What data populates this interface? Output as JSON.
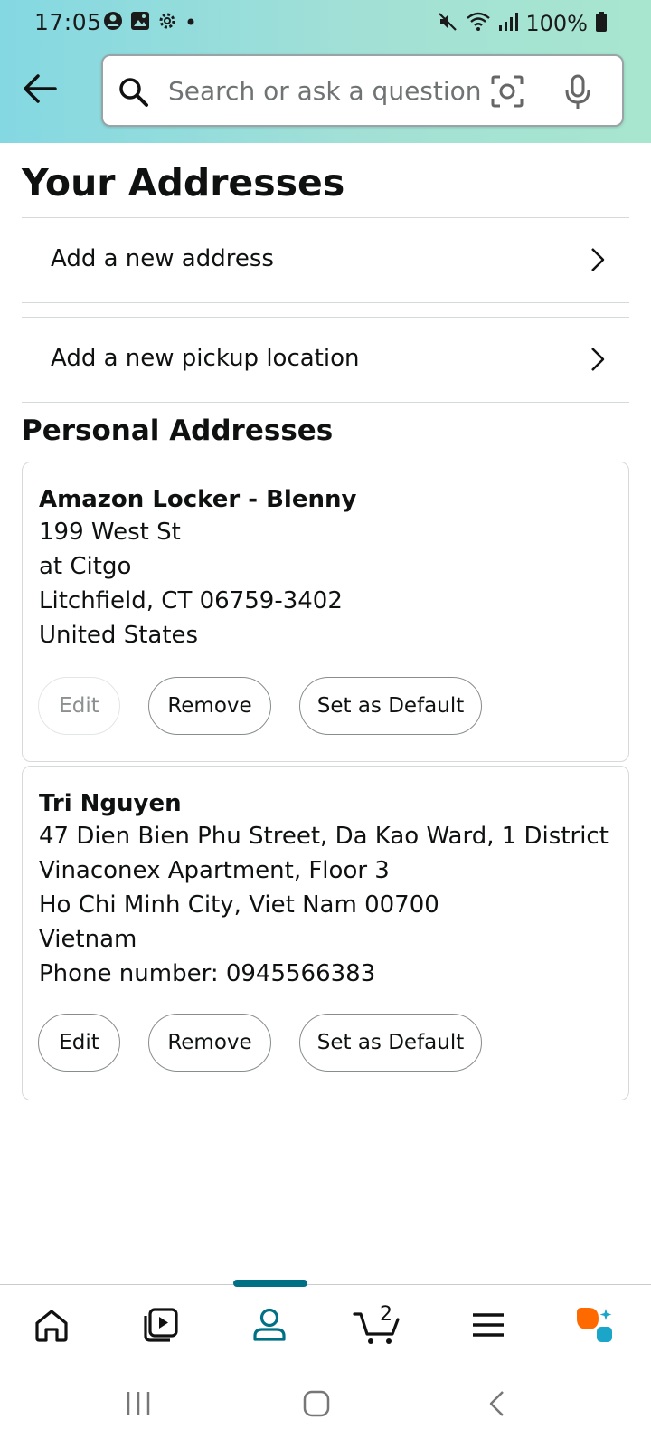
{
  "status_bar": {
    "time": "17:05",
    "battery": "100%"
  },
  "search": {
    "placeholder": "Search or ask a question"
  },
  "page": {
    "title": "Your Addresses",
    "links": [
      {
        "label": "Add a new address"
      },
      {
        "label": "Add a new pickup location"
      }
    ],
    "section_title": "Personal Addresses"
  },
  "addresses": [
    {
      "name": "Amazon Locker - Blenny",
      "lines": [
        "199 West St",
        "at Citgo",
        "Litchfield, CT 06759-3402",
        "United States"
      ],
      "edit_label": "Edit",
      "edit_enabled": false,
      "remove_label": "Remove",
      "default_label": "Set as Default"
    },
    {
      "name": "Tri Nguyen",
      "lines": [
        "47 Dien Bien Phu Street, Da Kao Ward, 1 District",
        "Vinaconex Apartment, Floor 3",
        "Ho Chi Minh City, Viet Nam 00700",
        "Vietnam",
        "Phone number: 0945566383"
      ],
      "edit_label": "Edit",
      "edit_enabled": true,
      "remove_label": "Remove",
      "default_label": "Set as Default"
    }
  ],
  "bottom_nav": {
    "items": [
      {
        "icon": "home-icon"
      },
      {
        "icon": "video-icon"
      },
      {
        "icon": "account-icon",
        "active": true
      },
      {
        "icon": "cart-icon",
        "count": "2"
      },
      {
        "icon": "menu-icon"
      },
      {
        "icon": "rufus-assistant-icon"
      }
    ],
    "active_color": "#007185"
  },
  "colors": {
    "header_gradient_start": "#84d8e2",
    "header_gradient_end": "#a8e6cf",
    "accent": "#007185",
    "assistant_orange": "#ff6a00",
    "assistant_teal": "#1ba5c9"
  }
}
